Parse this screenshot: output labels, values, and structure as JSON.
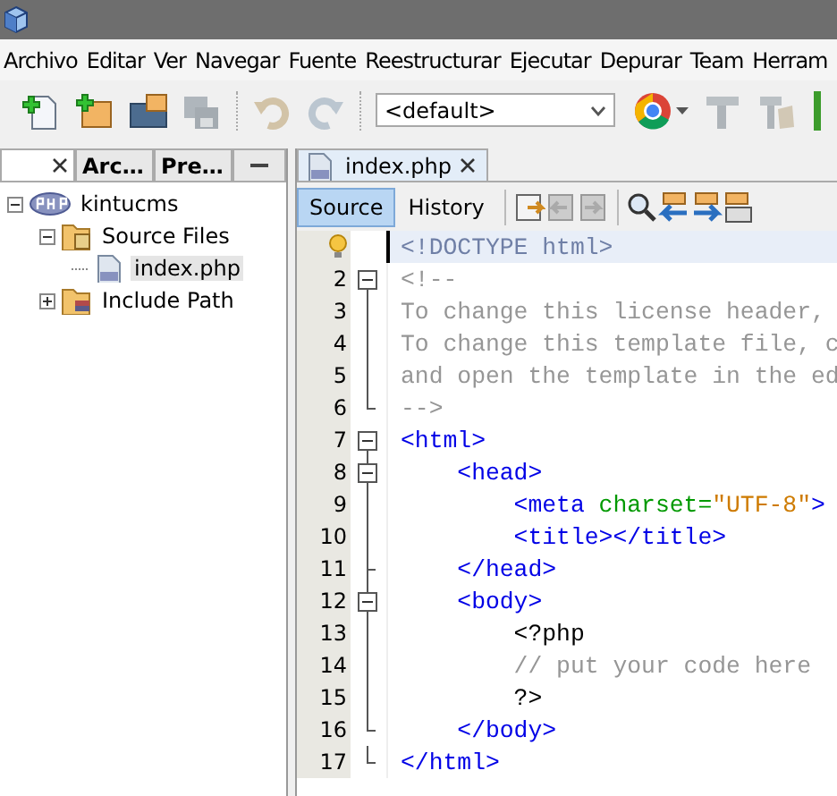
{
  "menu": [
    "Archivo",
    "Editar",
    "Ver",
    "Navegar",
    "Fuente",
    "Reestructurar",
    "Ejecutar",
    "Depurar",
    "Team",
    "Herram"
  ],
  "toolbar": {
    "buttons": [
      {
        "kind": "new-file",
        "disabled": false
      },
      {
        "kind": "new-project",
        "disabled": false
      },
      {
        "kind": "open-project",
        "disabled": false
      },
      {
        "kind": "save-all",
        "disabled": true
      },
      {
        "kind": "undo",
        "disabled": true
      },
      {
        "kind": "redo",
        "disabled": true
      }
    ],
    "config": "<default>",
    "run_buttons": [
      {
        "kind": "browser",
        "disabled": false
      },
      {
        "kind": "build",
        "disabled": true
      },
      {
        "kind": "clean-build",
        "disabled": true
      }
    ]
  },
  "side_tabs": [
    {
      "selected": true
    },
    {
      "label": "Arc…",
      "selected": false
    },
    {
      "label": "Pre…",
      "selected": false
    }
  ],
  "tree": [
    {
      "label": "kintucms",
      "kind": "project",
      "expanded": true,
      "selected": false,
      "children": [
        {
          "label": "Source Files",
          "kind": "source-folder",
          "expanded": true,
          "selected": false,
          "children": [
            {
              "label": "index.php",
              "kind": "php-file",
              "selected": true
            }
          ]
        },
        {
          "label": "Include Path",
          "kind": "library-folder",
          "expanded": false,
          "selected": false
        }
      ]
    }
  ],
  "editor_tabs": [
    {
      "label": "index.php",
      "selected": true
    }
  ],
  "view_tabs": [
    {
      "label": "Source",
      "selected": true
    },
    {
      "label": "History",
      "selected": false
    }
  ],
  "lines": [
    {
      "current": true,
      "kind": "plain",
      "segments": [
        {
          "kind": "doctype",
          "text": "<!DOCTYPE html>"
        }
      ]
    },
    {
      "number": "2",
      "current": false,
      "kind": "start",
      "segments": [
        {
          "kind": "comment",
          "text": "<!--"
        }
      ]
    },
    {
      "number": "3",
      "current": false,
      "kind": "inside",
      "segments": [
        {
          "kind": "comment",
          "text": "To change this license header,"
        }
      ]
    },
    {
      "number": "4",
      "current": false,
      "kind": "inside",
      "segments": [
        {
          "kind": "comment",
          "text": "To change this template file, c"
        }
      ]
    },
    {
      "number": "5",
      "current": false,
      "kind": "inside",
      "segments": [
        {
          "kind": "comment",
          "text": "and open the template in the ed"
        }
      ]
    },
    {
      "number": "6",
      "current": false,
      "kind": "end",
      "segments": [
        {
          "kind": "comment",
          "text": "-->"
        }
      ]
    },
    {
      "number": "7",
      "current": false,
      "kind": "start",
      "segments": [
        {
          "kind": "tag",
          "text": "<html>"
        }
      ]
    },
    {
      "number": "8",
      "current": false,
      "kind": "start",
      "segments": [
        {
          "kind": "tag",
          "text": "    <head>"
        }
      ]
    },
    {
      "number": "9",
      "current": false,
      "kind": "inside",
      "segments": [
        {
          "kind": "tag",
          "text": "        <meta "
        },
        {
          "kind": "attr",
          "text": "charset="
        },
        {
          "kind": "value",
          "text": "\"UTF-8\""
        },
        {
          "kind": "tag",
          "text": ">"
        }
      ]
    },
    {
      "number": "10",
      "current": false,
      "kind": "inside",
      "segments": [
        {
          "kind": "tag",
          "text": "        <title></title>"
        }
      ]
    },
    {
      "number": "11",
      "current": false,
      "kind": "end",
      "segments": [
        {
          "kind": "tag",
          "text": "    </head>"
        }
      ]
    },
    {
      "number": "12",
      "current": false,
      "kind": "start",
      "segments": [
        {
          "kind": "tag",
          "text": "    <body>"
        }
      ]
    },
    {
      "number": "13",
      "current": false,
      "kind": "inside",
      "segments": [
        {
          "kind": "php",
          "text": "        <?php"
        }
      ]
    },
    {
      "number": "14",
      "current": false,
      "kind": "inside",
      "segments": [
        {
          "kind": "comment",
          "text": "        // put your code here"
        }
      ]
    },
    {
      "number": "15",
      "current": false,
      "kind": "inside",
      "segments": [
        {
          "kind": "php",
          "text": "        ?>"
        }
      ]
    },
    {
      "number": "16",
      "current": false,
      "kind": "end",
      "segments": [
        {
          "kind": "tag",
          "text": "    </body>"
        }
      ]
    },
    {
      "number": "17",
      "current": false,
      "kind": "end",
      "segments": [
        {
          "kind": "tag",
          "text": "</html>"
        }
      ]
    }
  ]
}
